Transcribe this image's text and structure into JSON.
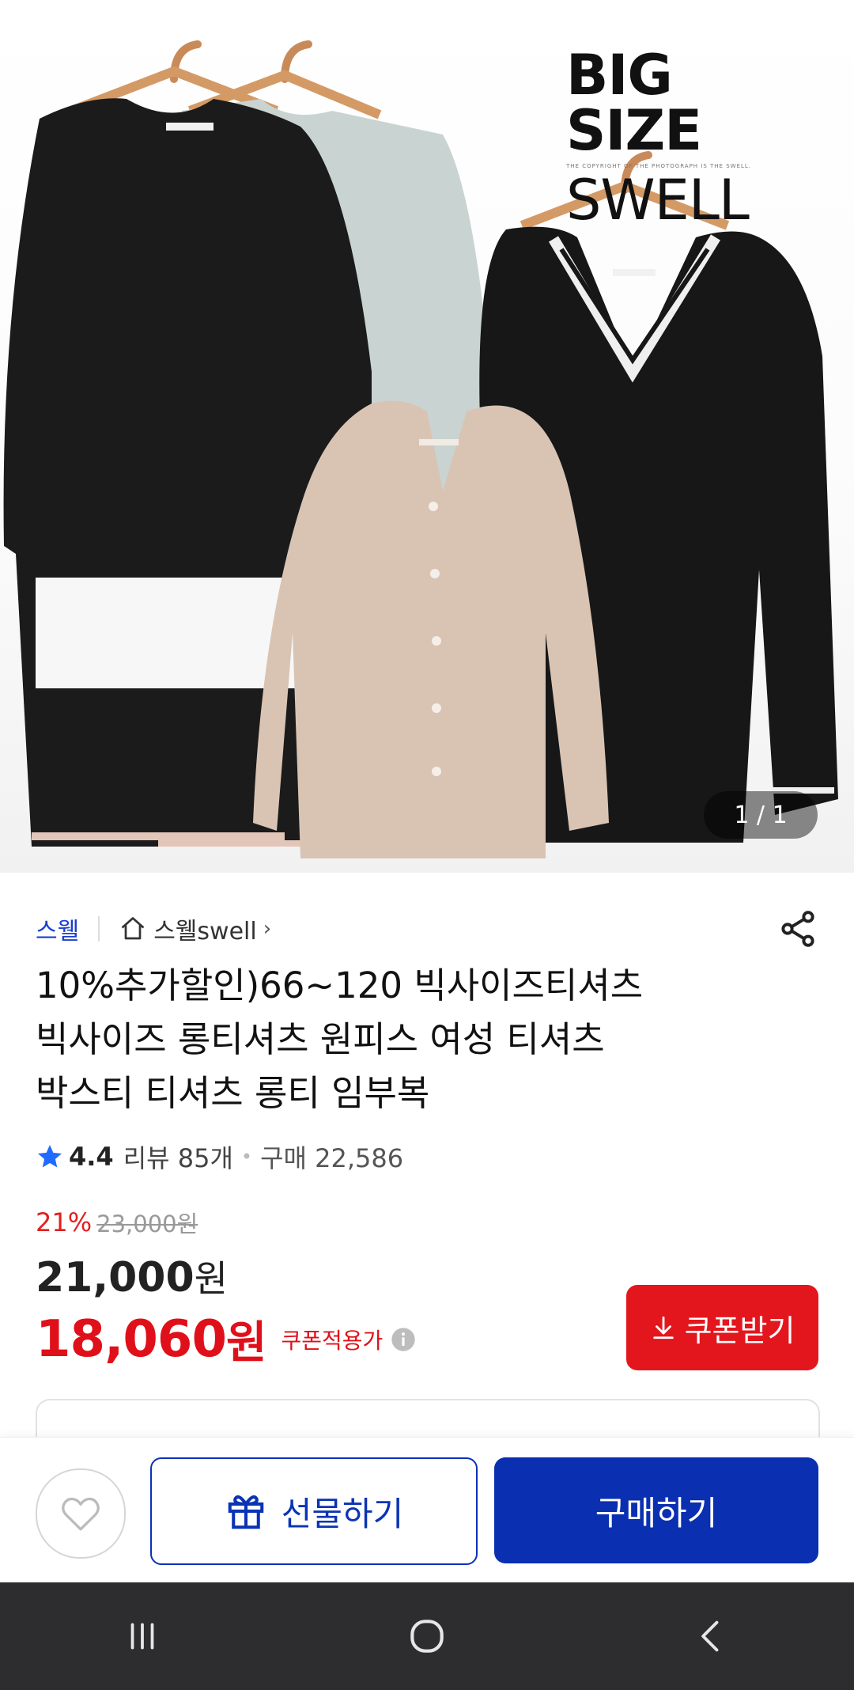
{
  "hero": {
    "logo_line1": "BIG SIZE",
    "logo_copyright": "THE COPYRIGHT OF THE PHOTOGRAPH IS THE SWELL.",
    "logo_line2": "SWELL",
    "image_counter": "1 / 1"
  },
  "seller": {
    "brand": "스웰",
    "store": "스웰swell",
    "store_arrow": "›"
  },
  "product": {
    "title": "10%추가할인)66~120 빅사이즈티셔츠\n빅사이즈 롱티셔츠 원피스 여성 티셔츠\n박스티 티셔츠 롱티 임부복"
  },
  "rating": {
    "score": "4.4",
    "reviews": "리뷰 85개",
    "separator": "•",
    "purchases": "구매 22,586"
  },
  "price": {
    "discount_rate": "21%",
    "original": "23,000원",
    "sale_number": "21,000",
    "sale_unit": "원",
    "coupon_number": "18,060",
    "coupon_unit": "원",
    "coupon_label": "쿠폰적용가"
  },
  "buttons": {
    "coupon": "쿠폰받기",
    "gift": "선물하기",
    "buy": "구매하기"
  },
  "colors": {
    "brand_blue": "#0a2fb0",
    "sale_red": "#e0101a",
    "coupon_red": "#e3161d"
  }
}
